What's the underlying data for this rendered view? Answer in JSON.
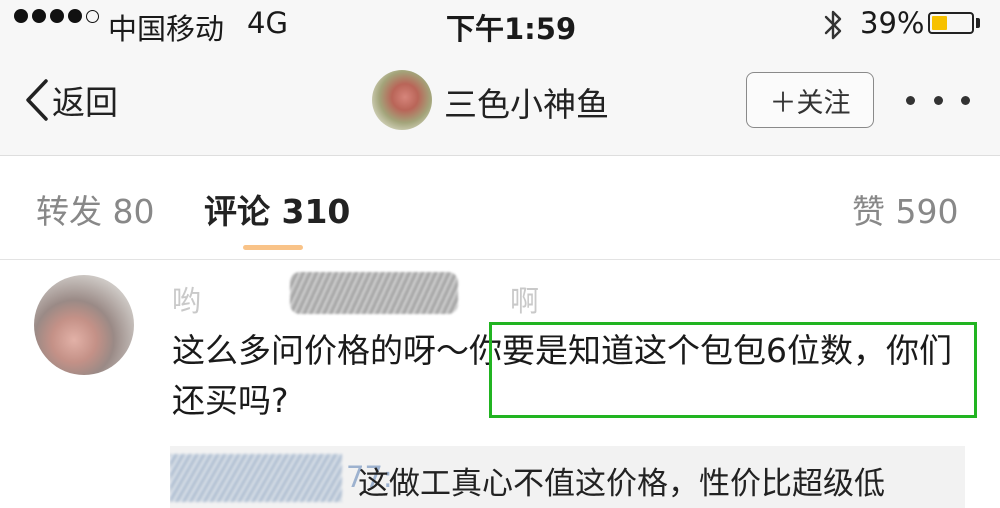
{
  "status_bar": {
    "carrier": "中国移动",
    "network": "4G",
    "time": "下午1:59",
    "battery_percent": "39%",
    "battery_level": 0.39,
    "signal_bars_filled": 4,
    "signal_bars_total": 5,
    "accent_battery": "#f7c100"
  },
  "nav": {
    "back_label": "返回",
    "title": "三色小神鱼",
    "follow_label": "＋关注"
  },
  "tabs": {
    "repost": "转发 80",
    "comment": "评论 310",
    "like": "赞 590",
    "active_color": "#f7b46a"
  },
  "comment": {
    "name_prefix": "哟",
    "name_suffix": "啊",
    "text": "这么多问价格的呀～你要是知道这个包包6位数，你们还买吗?",
    "highlight_color": "#21b421"
  },
  "reply": {
    "name_suffix": "77:",
    "text": "这做工真心不值这价格，性价比超级低"
  },
  "icons": [
    "chevron-left-icon",
    "bluetooth-icon",
    "battery-icon",
    "more-dots-icon",
    "signal-dots-icon"
  ]
}
